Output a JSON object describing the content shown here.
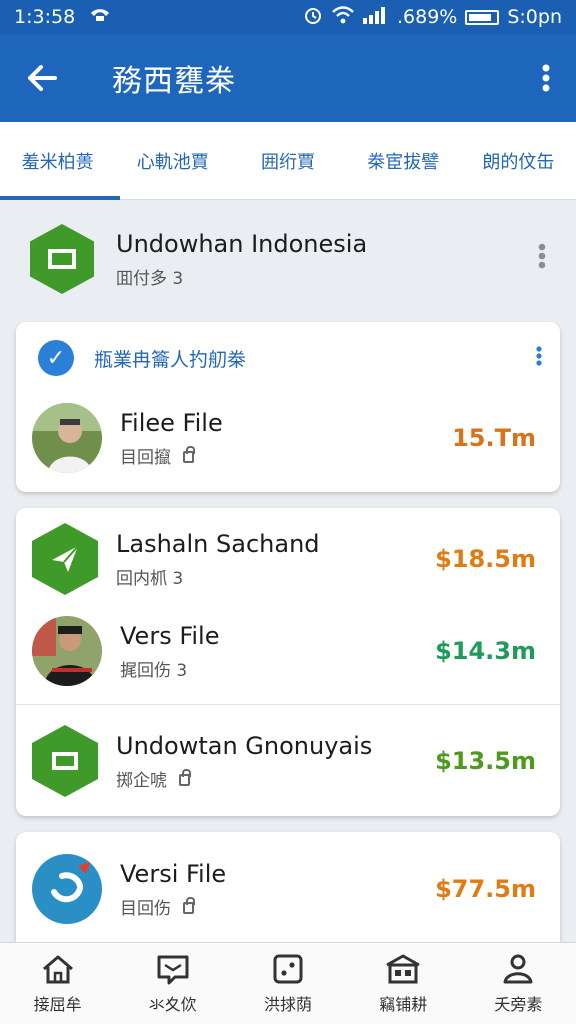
{
  "status": {
    "time": "1:3:58",
    "battery": ".689%",
    "clock": "S:0pn"
  },
  "app_bar": {
    "title": "務西甕桊"
  },
  "tabs": [
    "羞米柏蒉",
    "心軌池賈",
    "囲绗賈",
    "桊宦拔譬",
    "朗的伩缶"
  ],
  "header": {
    "name": "Undowhan Indonesia",
    "sub": "囬付多 3"
  },
  "card1": {
    "title": "瓶業冉籥人扚舠桊",
    "rows": [
      {
        "name": "Filee File",
        "sub": "目回攛",
        "amount": "15.Tm",
        "amount_color": "#d9731a"
      }
    ]
  },
  "card2": {
    "rows": [
      {
        "name": "Lashaln Sachand",
        "sub": "回内枛 3",
        "amount": "$18.5m",
        "amount_color": "#e07c12"
      },
      {
        "name": "Vers File",
        "sub": "捤回伤 3",
        "amount": "$14.3m",
        "amount_color": "#1f9a5a"
      },
      {
        "name": "Undowtan Gnonuyais",
        "sub": "掷企唬",
        "amount": "$13.5m",
        "amount_color": "#4e9a1e"
      }
    ]
  },
  "card3": {
    "rows": [
      {
        "name": "Versi File",
        "sub": "目回伤",
        "amount": "$77.5m",
        "amount_color": "#e07c12"
      }
    ]
  },
  "bottom_nav": [
    "接屈牟",
    "氺夊佽",
    "洪捄荫",
    "竊铺耕",
    "夭旁素"
  ],
  "colors": {
    "primary": "#1e66bc",
    "accent_green": "#3f9a2a",
    "tab_text": "#2467b6"
  },
  "icons": [
    "back-arrow-icon",
    "more-vert-icon",
    "hexagon-logo-icon",
    "check-circle-icon",
    "lock-icon",
    "home-icon",
    "message-icon",
    "dice-icon",
    "building-icon",
    "person-icon"
  ]
}
